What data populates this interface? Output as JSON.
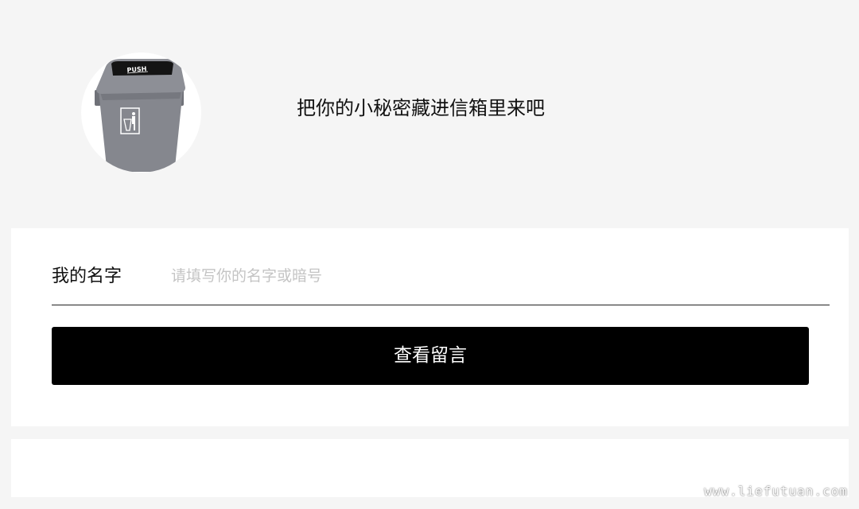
{
  "header": {
    "avatar_icon": "trash-bin-icon",
    "bin_lid_text": "PUSH",
    "tagline": "把你的小秘密藏进信箱里来吧"
  },
  "form": {
    "name_label": "我的名字",
    "name_placeholder": "请填写你的名字或暗号",
    "name_value": "",
    "submit_label": "查看留言"
  },
  "watermark": "www.liefutuan.com",
  "colors": {
    "page_bg": "#f5f5f5",
    "card_bg": "#ffffff",
    "button_bg": "#000000",
    "button_text": "#ffffff",
    "placeholder": "#c4c4c4"
  }
}
